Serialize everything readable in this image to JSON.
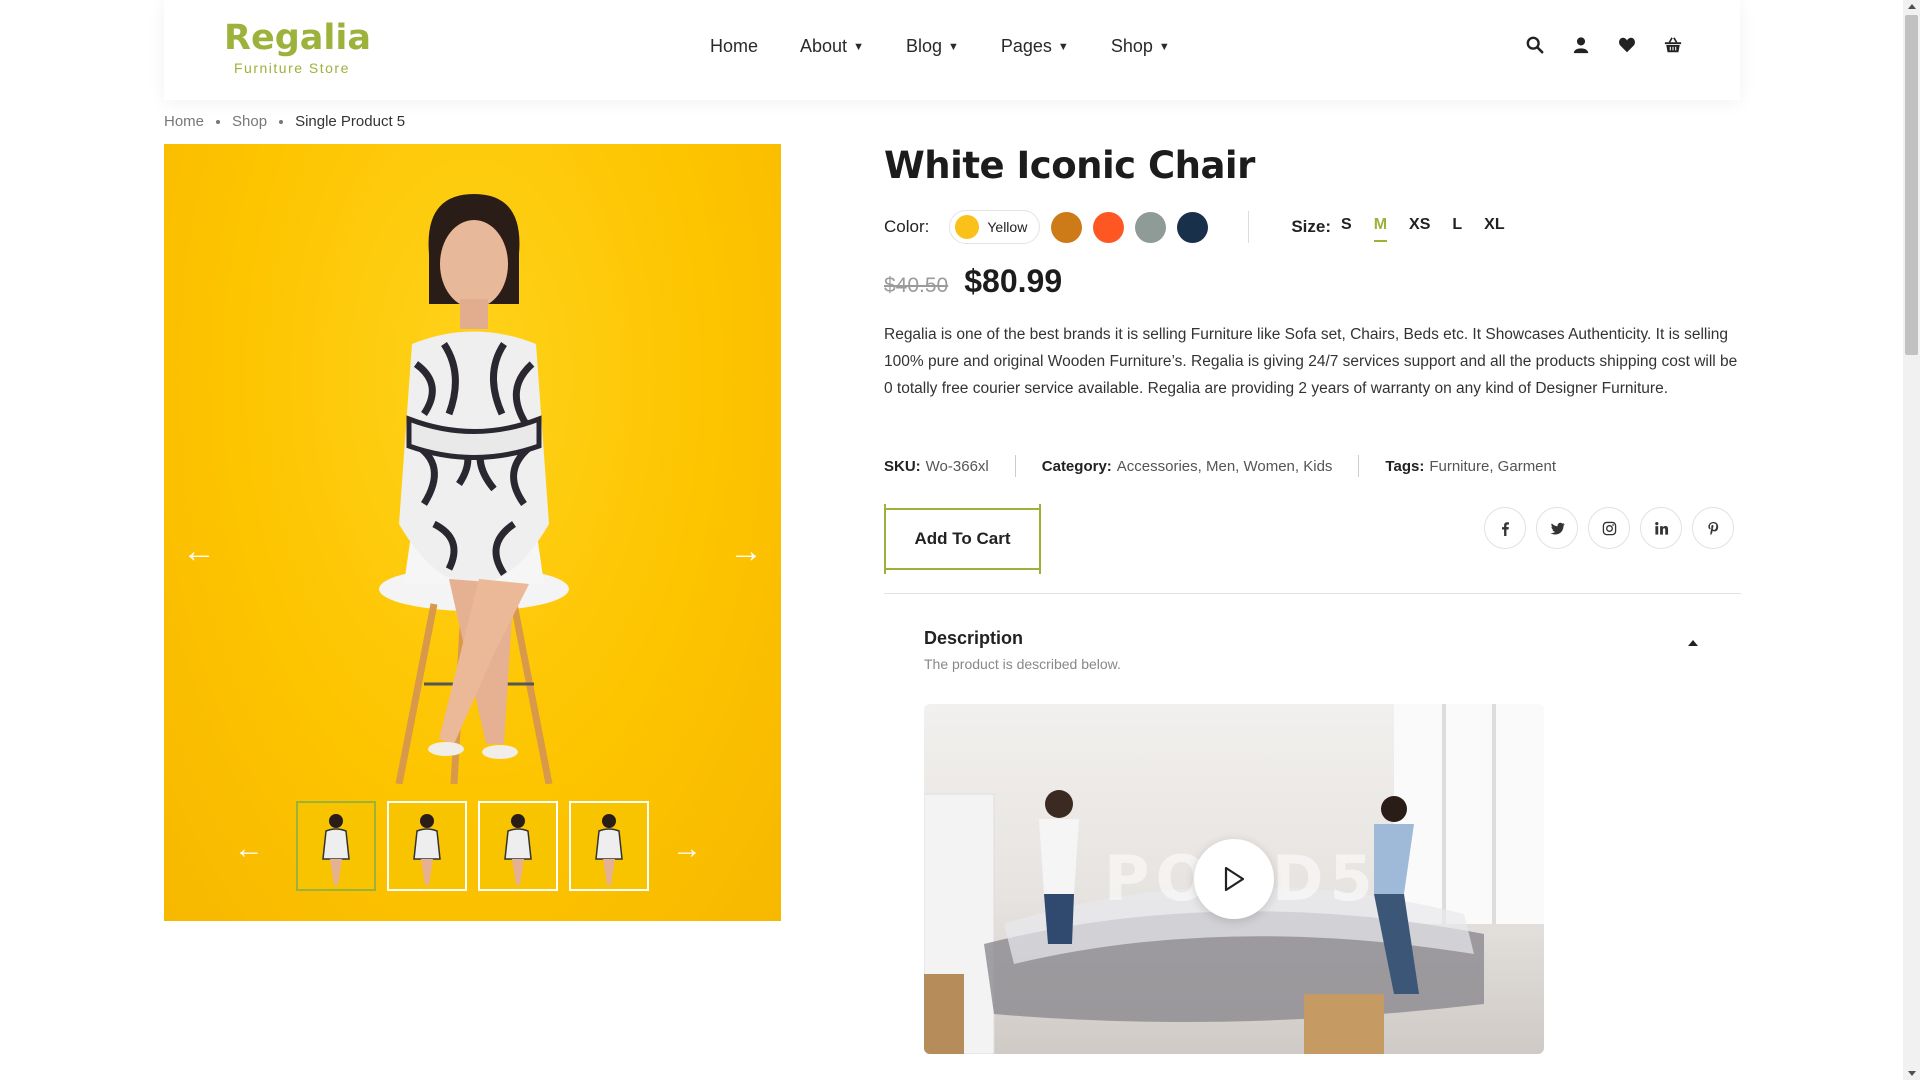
{
  "brand": {
    "name": "Regalia",
    "tagline": "Furniture Store"
  },
  "nav": [
    {
      "label": "Home",
      "has_dropdown": false
    },
    {
      "label": "About",
      "has_dropdown": true
    },
    {
      "label": "Blog",
      "has_dropdown": true
    },
    {
      "label": "Pages",
      "has_dropdown": true
    },
    {
      "label": "Shop",
      "has_dropdown": true
    }
  ],
  "header_icons": [
    "search-icon",
    "user-icon",
    "heart-icon",
    "basket-icon"
  ],
  "breadcrumb": {
    "home": "Home",
    "shop": "Shop",
    "current": "Single Product 5"
  },
  "product": {
    "title": "White Iconic Chair",
    "color_label": "Color:",
    "selected_color": "Yellow",
    "colors": [
      "#f9c11a",
      "#cd7a18",
      "#ff5722",
      "#8f9b97",
      "#19304a"
    ],
    "size_label": "Size:",
    "sizes": [
      "S",
      "M",
      "XS",
      "L",
      "XL"
    ],
    "active_size": "M",
    "old_price": "$40.50",
    "price": "$80.99",
    "description": "Regalia is one of the best brands it is selling Furniture like Sofa set, Chairs, Beds etc. It Showcases Authenticity. It is selling 100% pure and original Wooden Furniture’s. Regalia is giving 24/7 services support and all the products shipping cost will be 0 totally free courier service available. Regalia are providing 2 years of warranty on any kind of Designer Furniture.",
    "sku_label": "SKU:",
    "sku": "Wo-366xl",
    "category_label": "Category:",
    "categories": "Accessories, Men, Women, Kids",
    "tags_label": "Tags:",
    "tags": "Furniture, Garment",
    "add_to_cart": "Add To Cart"
  },
  "socials": [
    "facebook-icon",
    "twitter-icon",
    "instagram-icon",
    "linkedin-icon",
    "pinterest-icon"
  ],
  "accordion": {
    "title": "Description",
    "subtitle": "The product is described below."
  },
  "video": {
    "watermark": "POND5"
  },
  "colors": {
    "accent": "#9cb23a",
    "gallery_bg": "#fdc400"
  }
}
